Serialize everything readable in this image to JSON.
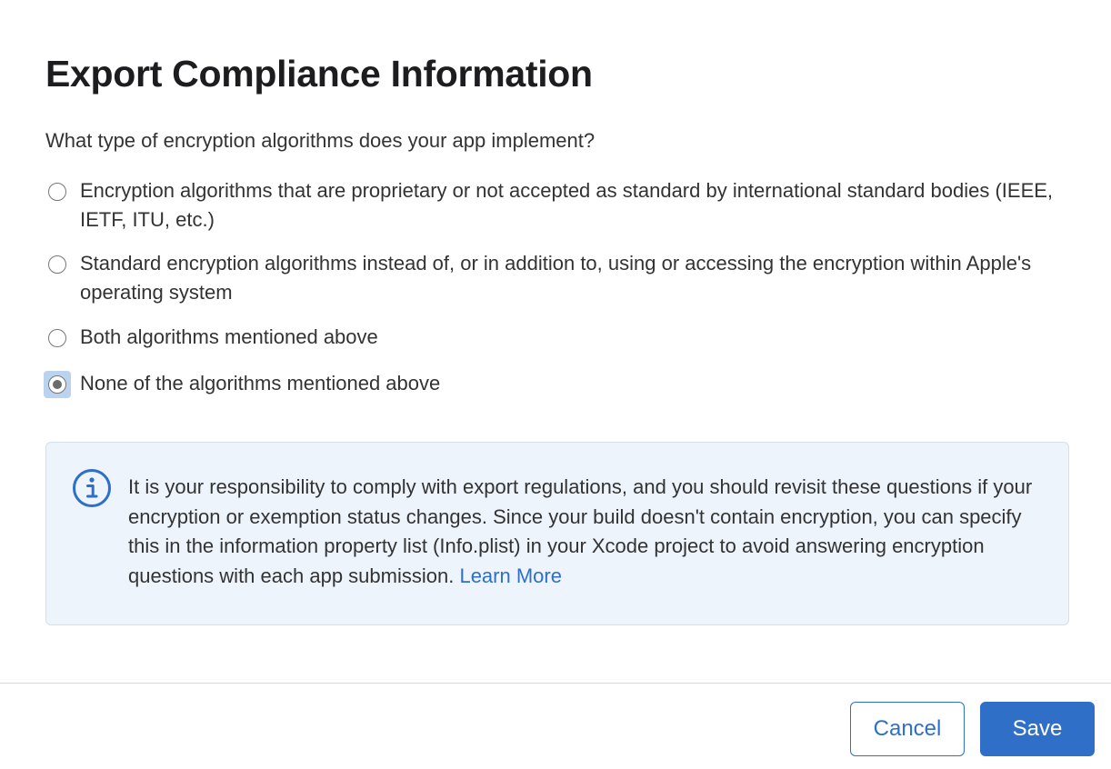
{
  "dialog": {
    "title": "Export Compliance Information",
    "question": "What type of encryption algorithms does your app implement?",
    "options": [
      {
        "label": "Encryption algorithms that are proprietary or not accepted as standard by international standard bodies (IEEE, IETF, ITU, etc.)",
        "selected": false
      },
      {
        "label": "Standard encryption algorithms instead of, or in addition to, using or accessing the encryption within Apple's operating system",
        "selected": false
      },
      {
        "label": "Both algorithms mentioned above",
        "selected": false
      },
      {
        "label": "None of the algorithms mentioned above",
        "selected": true
      }
    ],
    "info": {
      "icon": "info-icon",
      "text": "It is your responsibility to comply with export regulations, and you should revisit these questions if your encryption or exemption status changes. Since your build doesn't contain encryption, you can specify this in the information property list (Info.plist) in your Xcode project to avoid answering encryption questions with each app submission.",
      "link_label": "Learn More"
    }
  },
  "footer": {
    "cancel_label": "Cancel",
    "save_label": "Save"
  },
  "colors": {
    "accent": "#2d6fc9",
    "info_background": "#edf4fb",
    "info_border": "#d6e0ea",
    "focus_ring": "#bcd3f0"
  }
}
